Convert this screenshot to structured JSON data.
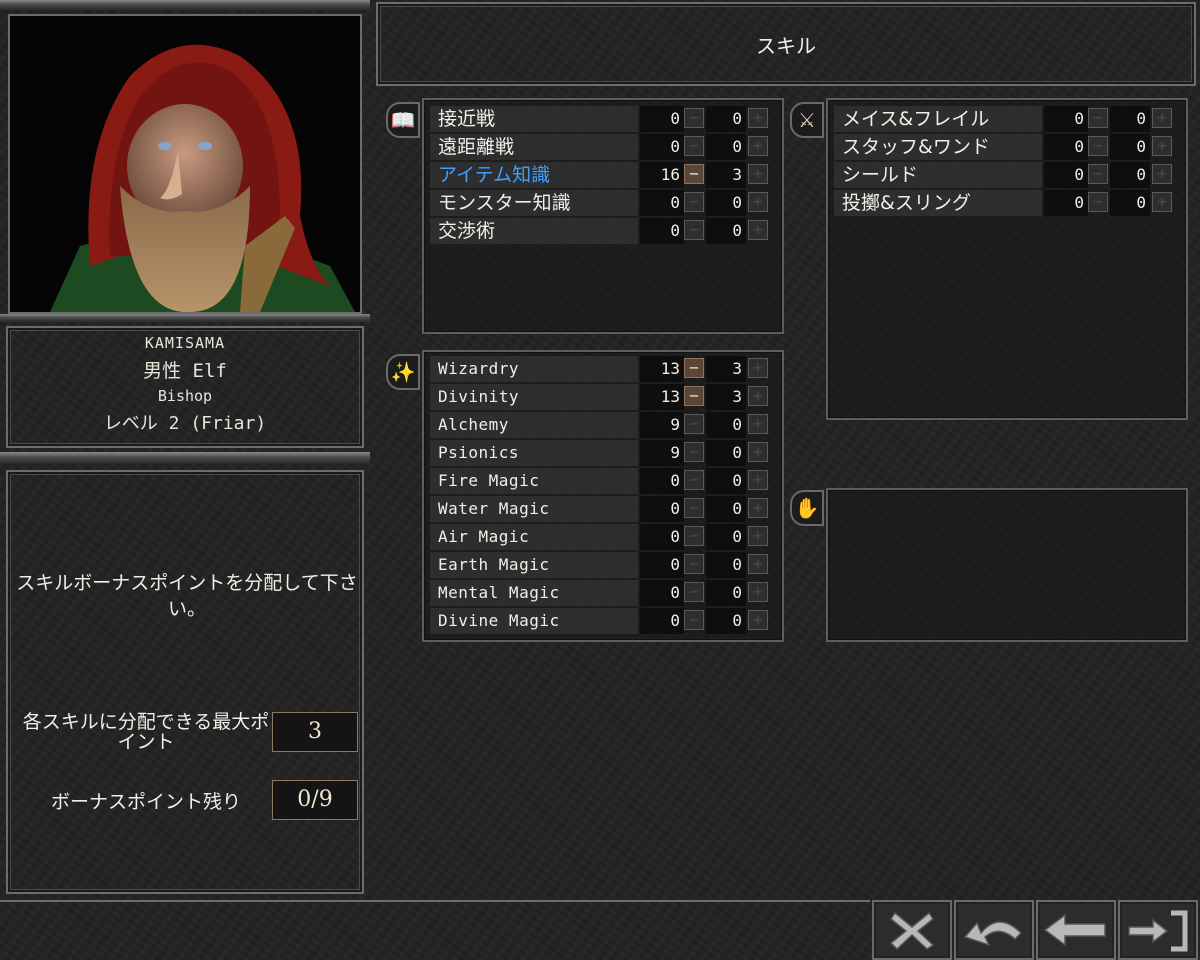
{
  "title": "スキル",
  "character": {
    "name": "KAMISAMA",
    "gender_race": "男性 Elf",
    "class": "Bishop",
    "level_line": "レベル 2 (Friar)"
  },
  "instructions": "スキルボーナスポイントを分配して下さい。",
  "max_per_skill": {
    "label": "各スキルに分配できる最大ポイント",
    "value": "3"
  },
  "bonus_remaining": {
    "label": "ボーナスポイント残り",
    "value": "0/9"
  },
  "skill_groups": {
    "general": {
      "icon": "book-icon",
      "skills": [
        {
          "name": "接近戦",
          "value": "0",
          "bonus": "0",
          "highlight": false,
          "minus_active": false
        },
        {
          "name": "遠距離戦",
          "value": "0",
          "bonus": "0",
          "highlight": false,
          "minus_active": false
        },
        {
          "name": "アイテム知識",
          "value": "16",
          "bonus": "3",
          "highlight": true,
          "minus_active": true
        },
        {
          "name": "モンスター知識",
          "value": "0",
          "bonus": "0",
          "highlight": false,
          "minus_active": false
        },
        {
          "name": "交渉術",
          "value": "0",
          "bonus": "0",
          "highlight": false,
          "minus_active": false
        }
      ]
    },
    "weapons": {
      "icon": "sword-icon",
      "skills": [
        {
          "name": "メイス&フレイル",
          "value": "0",
          "bonus": "0",
          "highlight": false,
          "minus_active": false
        },
        {
          "name": "スタッフ&ワンド",
          "value": "0",
          "bonus": "0",
          "highlight": false,
          "minus_active": false
        },
        {
          "name": "シールド",
          "value": "0",
          "bonus": "0",
          "highlight": false,
          "minus_active": false
        },
        {
          "name": "投擲&スリング",
          "value": "0",
          "bonus": "0",
          "highlight": false,
          "minus_active": false
        }
      ]
    },
    "magic": {
      "icon": "wand-icon",
      "skills": [
        {
          "name": "Wizardry",
          "value": "13",
          "bonus": "3",
          "highlight": false,
          "minus_active": true
        },
        {
          "name": "Divinity",
          "value": "13",
          "bonus": "3",
          "highlight": false,
          "minus_active": true
        },
        {
          "name": "Alchemy",
          "value": "9",
          "bonus": "0",
          "highlight": false,
          "minus_active": false
        },
        {
          "name": "Psionics",
          "value": "9",
          "bonus": "0",
          "highlight": false,
          "minus_active": false
        },
        {
          "name": "Fire Magic",
          "value": "0",
          "bonus": "0",
          "highlight": false,
          "minus_active": false
        },
        {
          "name": "Water Magic",
          "value": "0",
          "bonus": "0",
          "highlight": false,
          "minus_active": false
        },
        {
          "name": "Air Magic",
          "value": "0",
          "bonus": "0",
          "highlight": false,
          "minus_active": false
        },
        {
          "name": "Earth Magic",
          "value": "0",
          "bonus": "0",
          "highlight": false,
          "minus_active": false
        },
        {
          "name": "Mental Magic",
          "value": "0",
          "bonus": "0",
          "highlight": false,
          "minus_active": false
        },
        {
          "name": "Divine Magic",
          "value": "0",
          "bonus": "0",
          "highlight": false,
          "minus_active": false
        }
      ]
    },
    "personal": {
      "icon": "hand-icon",
      "skills": []
    }
  },
  "buttons": {
    "minus_glyph": "−",
    "plus_glyph": "+"
  },
  "nav": [
    {
      "name": "cancel-button",
      "icon": "x-icon"
    },
    {
      "name": "undo-button",
      "icon": "undo-arrow-icon"
    },
    {
      "name": "back-button",
      "icon": "left-arrow-icon"
    },
    {
      "name": "next-button",
      "icon": "exit-arrow-icon"
    }
  ],
  "colors": {
    "highlight": "#3fa0ff",
    "active_button": "#5a4636",
    "text": "#f2efe6"
  }
}
